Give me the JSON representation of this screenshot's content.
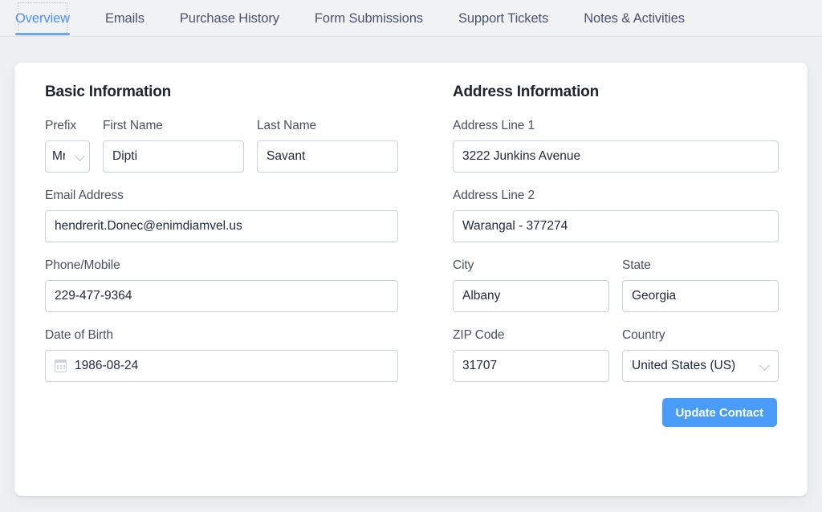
{
  "tabs": [
    {
      "label": "Overview",
      "active": true
    },
    {
      "label": "Emails",
      "active": false
    },
    {
      "label": "Purchase History",
      "active": false
    },
    {
      "label": "Form Submissions",
      "active": false
    },
    {
      "label": "Support Tickets",
      "active": false
    },
    {
      "label": "Notes & Activities",
      "active": false
    }
  ],
  "basic": {
    "title": "Basic Information",
    "prefix": {
      "label": "Prefix",
      "value": "Mr",
      "icon": "chevron-down-icon"
    },
    "first_name": {
      "label": "First Name",
      "value": "Dipti"
    },
    "last_name": {
      "label": "Last Name",
      "value": "Savant"
    },
    "email": {
      "label": "Email Address",
      "value": "hendrerit.Donec@enimdiamvel.us"
    },
    "phone": {
      "label": "Phone/Mobile",
      "value": "229-477-9364"
    },
    "dob": {
      "label": "Date of Birth",
      "value": "1986-08-24",
      "icon": "calendar-icon"
    }
  },
  "address": {
    "title": "Address Information",
    "line1": {
      "label": "Address Line 1",
      "value": "3222  Junkins Avenue"
    },
    "line2": {
      "label": "Address Line 2",
      "value": "Warangal - 377274"
    },
    "city": {
      "label": "City",
      "value": "Albany"
    },
    "state": {
      "label": "State",
      "value": "Georgia"
    },
    "zip": {
      "label": "ZIP Code",
      "value": "31707"
    },
    "country": {
      "label": "Country",
      "value": "United States (US)",
      "icon": "chevron-down-icon"
    }
  },
  "footer": {
    "submit_label": "Update Contact"
  },
  "colors": {
    "accent": "#4a9cfa",
    "tab_active": "#4a90f7",
    "tab_inactive": "#48536a",
    "page_bg": "#eff0f2",
    "border": "#ccd2dc"
  }
}
